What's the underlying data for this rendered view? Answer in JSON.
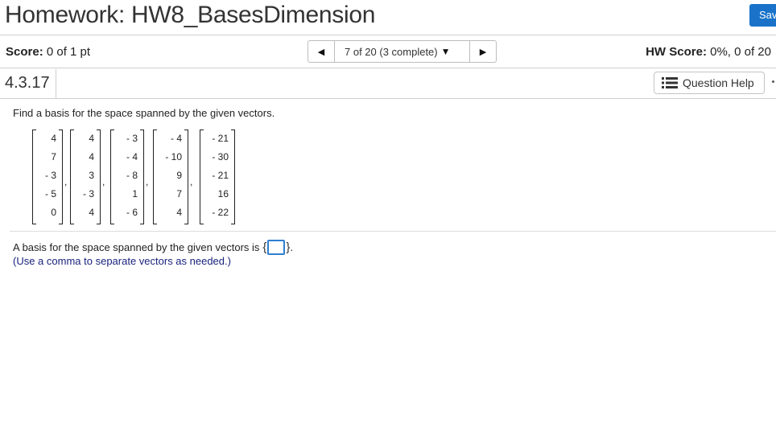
{
  "header": {
    "title": "Homework: HW8_BasesDimension",
    "save_label": "Save"
  },
  "score": {
    "label": "Score:",
    "value": "0 of 1 pt"
  },
  "navigation": {
    "prev_icon": "triangle-left-icon",
    "position_text": "7 of 20 (3 complete)",
    "dropdown_icon": "triangle-down-icon",
    "next_icon": "triangle-right-icon"
  },
  "hw_score": {
    "label": "HW Score:",
    "value": "0%, 0 of 20"
  },
  "question": {
    "number": "4.3.17",
    "help_label": "Question Help",
    "help_icon": "list-menu-icon",
    "prompt": "Find a basis for the space spanned by the given vectors.",
    "vectors": [
      [
        "4",
        "7",
        "- 3",
        "- 5",
        "0"
      ],
      [
        "4",
        "4",
        "3",
        "- 3",
        "4"
      ],
      [
        "- 3",
        "- 4",
        "- 8",
        "1",
        "- 6"
      ],
      [
        "- 4",
        "- 10",
        "9",
        "7",
        "4"
      ],
      [
        "- 21",
        "- 30",
        "- 21",
        "16",
        "- 22"
      ]
    ],
    "answer_text": "A basis for the space spanned by the given vectors is",
    "answer_value": "",
    "note": "(Use a comma to separate vectors as needed.)"
  },
  "colors": {
    "accent": "#1a73c9",
    "input_border": "#2f7fd0",
    "note_text": "#1a237e"
  }
}
